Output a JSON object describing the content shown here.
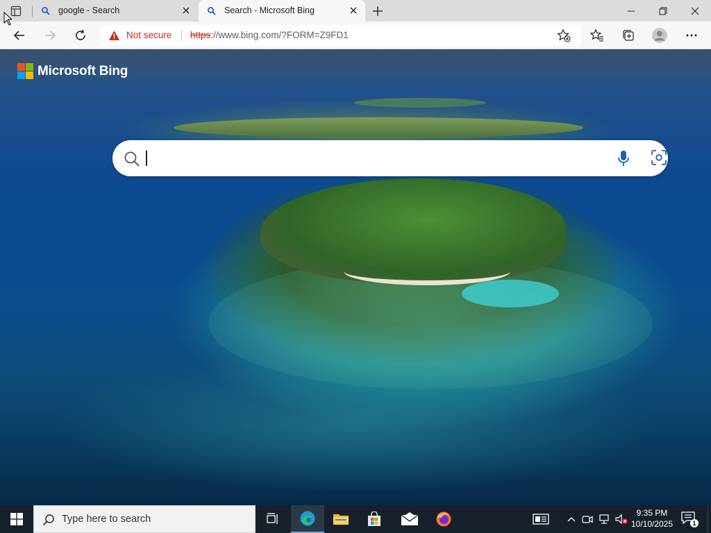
{
  "browser": {
    "tabs": [
      {
        "title": "google - Search",
        "favicon": "search-icon",
        "active": false
      },
      {
        "title": "Search - Microsoft Bing",
        "favicon": "search-icon",
        "active": true
      }
    ],
    "window_controls": [
      "minimize-icon",
      "restore-icon",
      "close-icon"
    ],
    "toolbar": {
      "back": "back-arrow-icon",
      "forward": "forward-arrow-icon",
      "refresh": "refresh-icon",
      "address": {
        "security_label": "Not secure",
        "url_scheme": "https",
        "url_rest": "://www.bing.com/?FORM=Z9FD1",
        "url_host_part": "www.bing.com"
      },
      "right_buttons": [
        "add-favorite-icon",
        "favorites-icon",
        "collections-icon",
        "profile-icon",
        "more-icon"
      ]
    }
  },
  "page": {
    "logo_text": "Microsoft Bing",
    "search": {
      "value": "",
      "placeholder": ""
    }
  },
  "taskbar": {
    "search_placeholder": "Type here to search",
    "pinned_apps": [
      "task-view-icon",
      "edge-icon",
      "file-explorer-icon",
      "store-icon",
      "mail-icon",
      "firefox-icon"
    ],
    "clock_time": "9:35 PM",
    "clock_date": "10/10/2025",
    "notification_count": "1"
  },
  "colors": {
    "accent": "#0078d4",
    "not_secure": "#c42b1c",
    "taskbar": "#15202b"
  }
}
